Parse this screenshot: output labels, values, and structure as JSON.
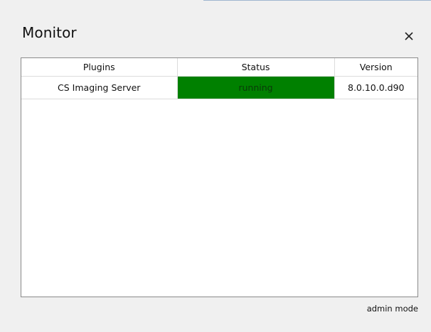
{
  "window": {
    "title": "Monitor",
    "close_icon": "close-icon"
  },
  "table": {
    "columns": [
      "Plugins",
      "Status",
      "Version"
    ],
    "rows": [
      {
        "plugin": "CS Imaging Server",
        "status": "running",
        "status_color": "#008000",
        "version": "8.0.10.0.d90"
      }
    ]
  },
  "footer": {
    "mode": "admin mode"
  }
}
